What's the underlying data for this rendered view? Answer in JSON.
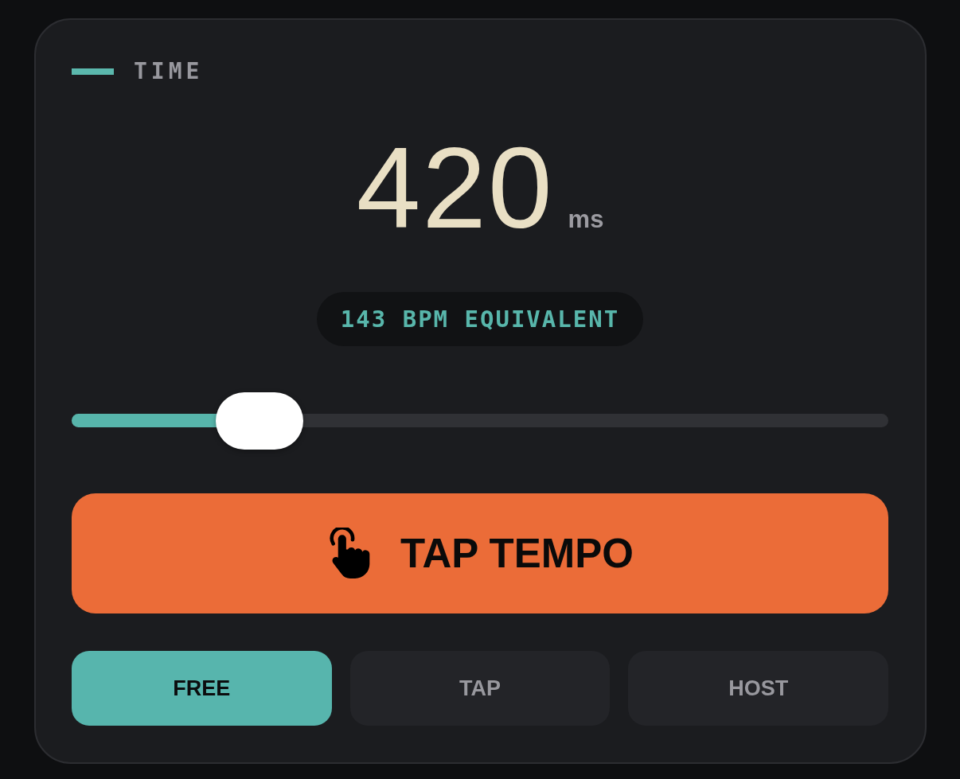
{
  "section": {
    "title": "TIME"
  },
  "readout": {
    "value": "420",
    "unit": "ms"
  },
  "equivalent": {
    "text": "143 BPM EQUIVALENT"
  },
  "slider": {
    "level": 0.23
  },
  "tap_button": {
    "label": "TAP TEMPO"
  },
  "modes": [
    {
      "label": "FREE",
      "selected": true
    },
    {
      "label": "TAP",
      "selected": false
    },
    {
      "label": "HOST",
      "selected": false
    }
  ]
}
